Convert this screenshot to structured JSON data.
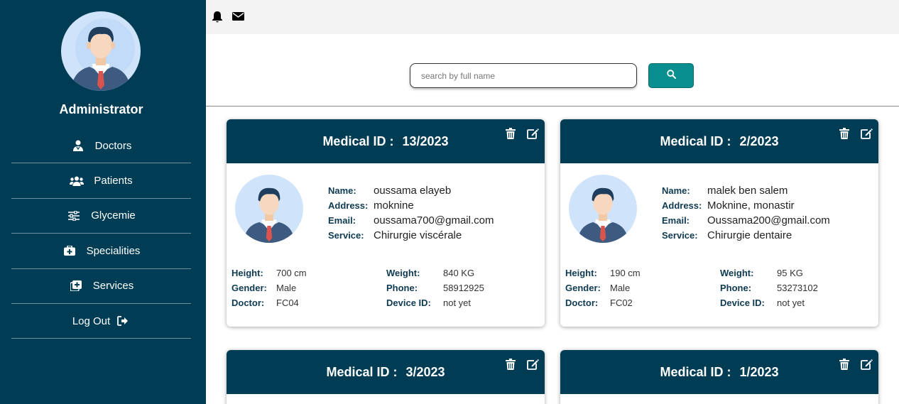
{
  "sidebar": {
    "role": "Administrator",
    "items": [
      {
        "label": "Doctors",
        "icon": "user-doctor-icon"
      },
      {
        "label": "Patients",
        "icon": "users-icon"
      },
      {
        "label": "Glycemie",
        "icon": "sliders-icon"
      },
      {
        "label": "Specialities",
        "icon": "medkit-icon"
      },
      {
        "label": "Services",
        "icon": "square-plus-icon"
      },
      {
        "label": "Log Out",
        "icon": "logout-icon"
      }
    ]
  },
  "topbar": {
    "icons": [
      "bell-icon",
      "envelope-icon"
    ]
  },
  "search": {
    "placeholder": "search by full name",
    "value": ""
  },
  "labels": {
    "medical_id": "Medical ID :",
    "name": "Name:",
    "address": "Address:",
    "email": "Email:",
    "service": "Service:",
    "height": "Height:",
    "gender": "Gender:",
    "doctor": "Doctor:",
    "weight": "Weight:",
    "phone": "Phone:",
    "device": "Device ID:"
  },
  "patients": [
    {
      "medical_id": "13/2023",
      "name": "oussama elayeb",
      "address": "moknine",
      "email": "oussama700@gmail.com",
      "service": "Chirurgie viscérale",
      "height": "700 cm",
      "gender": "Male",
      "doctor": "FC04",
      "weight": "840 KG",
      "phone": "58912925",
      "device": "not yet"
    },
    {
      "medical_id": "2/2023",
      "name": "malek ben salem",
      "address": "Moknine, monastir",
      "email": "Oussama200@gmail.com",
      "service": "Chirurgie dentaire",
      "height": "190 cm",
      "gender": "Male",
      "doctor": "FC02",
      "weight": "95 KG",
      "phone": "53273102",
      "device": "not yet"
    },
    {
      "medical_id": "3/2023"
    },
    {
      "medical_id": "1/2023"
    }
  ],
  "colors": {
    "sidebar": "#003d54",
    "accent": "#0a8f91",
    "card_header": "#003d54"
  }
}
